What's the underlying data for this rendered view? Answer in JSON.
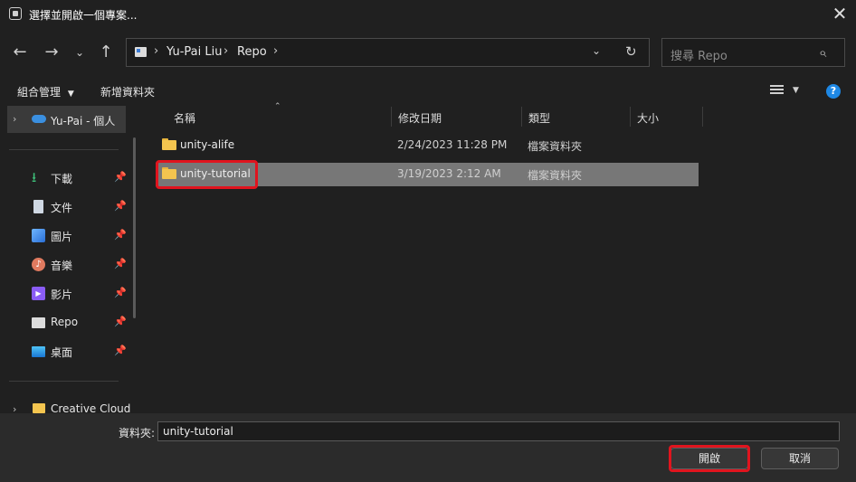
{
  "window": {
    "title": "選擇並開啟一個專案..."
  },
  "nav": {
    "back_icon": "arrow-left-icon",
    "forward_icon": "arrow-right-icon",
    "recent_icon": "chevron-down-icon",
    "up_icon": "arrow-up-icon"
  },
  "address": {
    "crumbs": [
      "Yu-Pai Liu",
      "Repo"
    ]
  },
  "search": {
    "placeholder": "搜尋 Repo"
  },
  "toolbar": {
    "organize_label": "組合管理",
    "new_folder_label": "新增資料夾"
  },
  "sidebar": {
    "onedrive_label": "Yu-Pai - 個人",
    "items": [
      {
        "label": "下載",
        "icon": "download-icon"
      },
      {
        "label": "文件",
        "icon": "document-icon"
      },
      {
        "label": "圖片",
        "icon": "picture-icon"
      },
      {
        "label": "音樂",
        "icon": "music-icon"
      },
      {
        "label": "影片",
        "icon": "video-icon"
      },
      {
        "label": "Repo",
        "icon": "folder-icon"
      },
      {
        "label": "桌面",
        "icon": "desktop-icon"
      }
    ],
    "creative_cloud_label": "Creative Cloud"
  },
  "columns": {
    "name": "名稱",
    "modified": "修改日期",
    "type": "類型",
    "size": "大小"
  },
  "files": [
    {
      "name": "unity-alife",
      "modified": "2/24/2023 11:28 PM",
      "type": "檔案資料夾"
    },
    {
      "name": "unity-tutorial",
      "modified": "3/19/2023 2:12 AM",
      "type": "檔案資料夾"
    }
  ],
  "footer": {
    "folder_label": "資料夾:",
    "folder_value": "unity-tutorial",
    "open_label": "開啟",
    "cancel_label": "取消"
  },
  "colors": {
    "accent": "#1e88e5",
    "selection": "#777777",
    "highlight": "#e0141e"
  }
}
